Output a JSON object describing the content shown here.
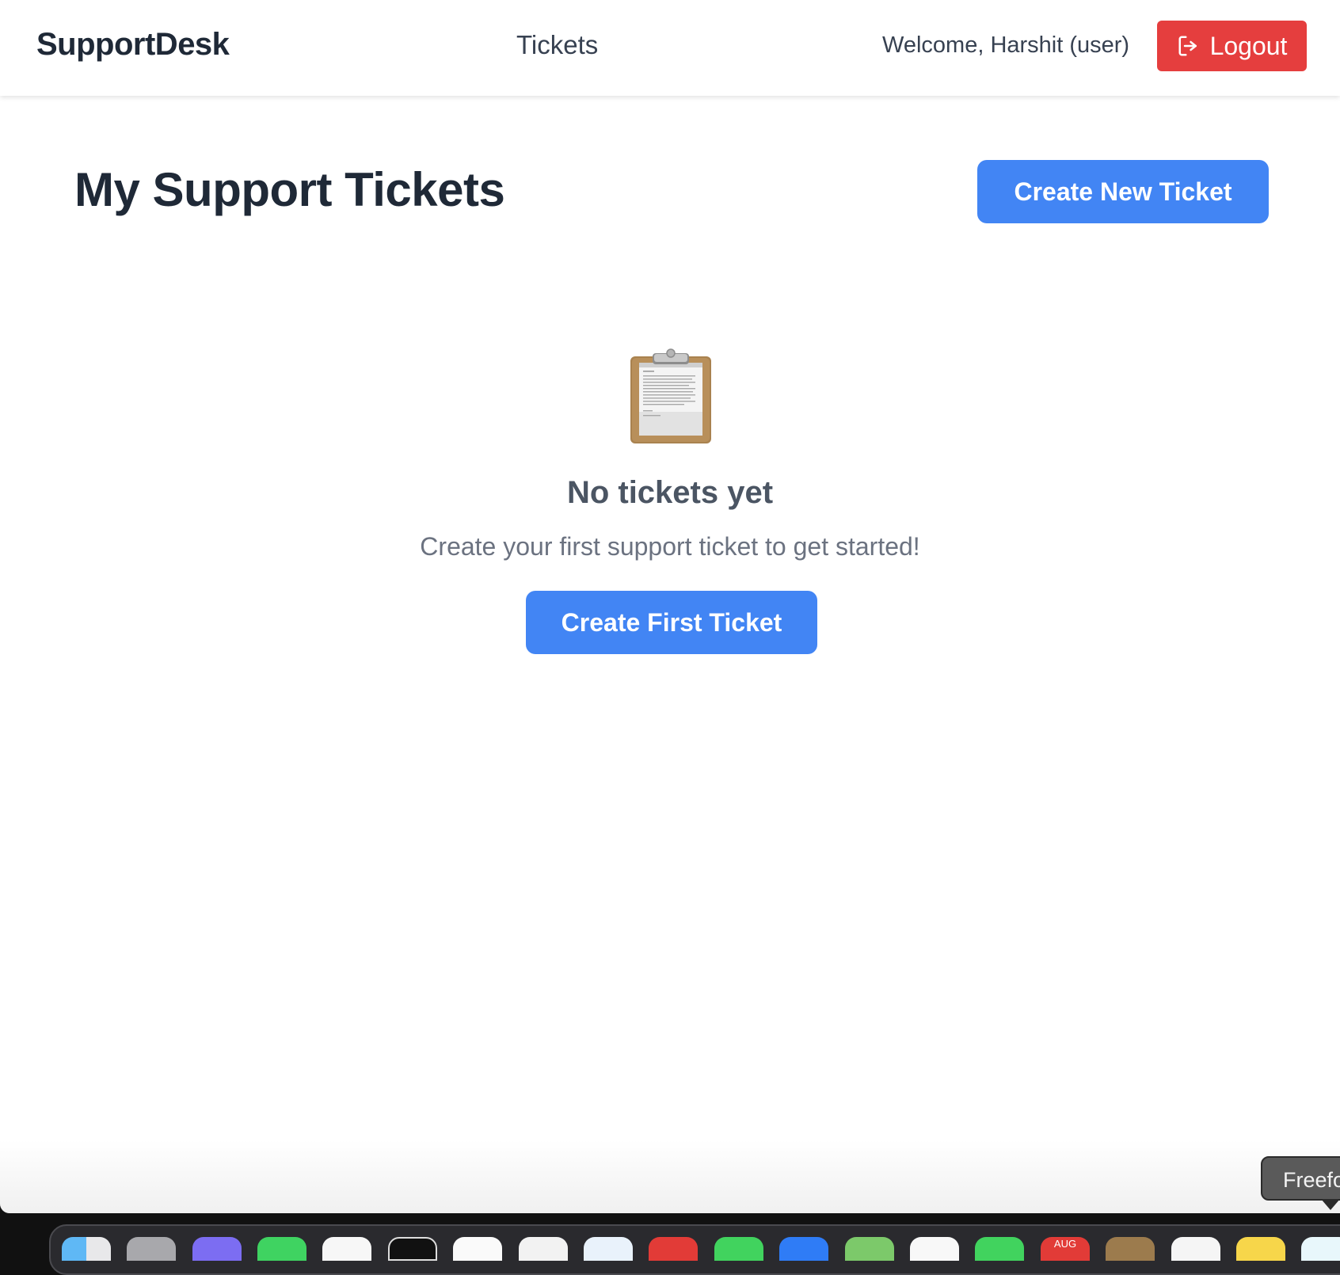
{
  "navbar": {
    "brand": "SupportDesk",
    "nav_link": "Tickets",
    "welcome": "Welcome, Harshit (user)",
    "logout_label": "Logout"
  },
  "main": {
    "title": "My Support Tickets",
    "create_new_label": "Create New Ticket"
  },
  "empty_state": {
    "icon": "clipboard-icon",
    "title": "No tickets yet",
    "subtitle": "Create your first support ticket to get started!",
    "button_label": "Create First Ticket"
  },
  "tooltip": {
    "text": "Freefo"
  },
  "dock": {
    "calendar_month": "AUG"
  },
  "colors": {
    "primary": "#4285f4",
    "danger": "#e53e3e",
    "text_dark": "#1f2937",
    "text_muted": "#6b7280"
  }
}
